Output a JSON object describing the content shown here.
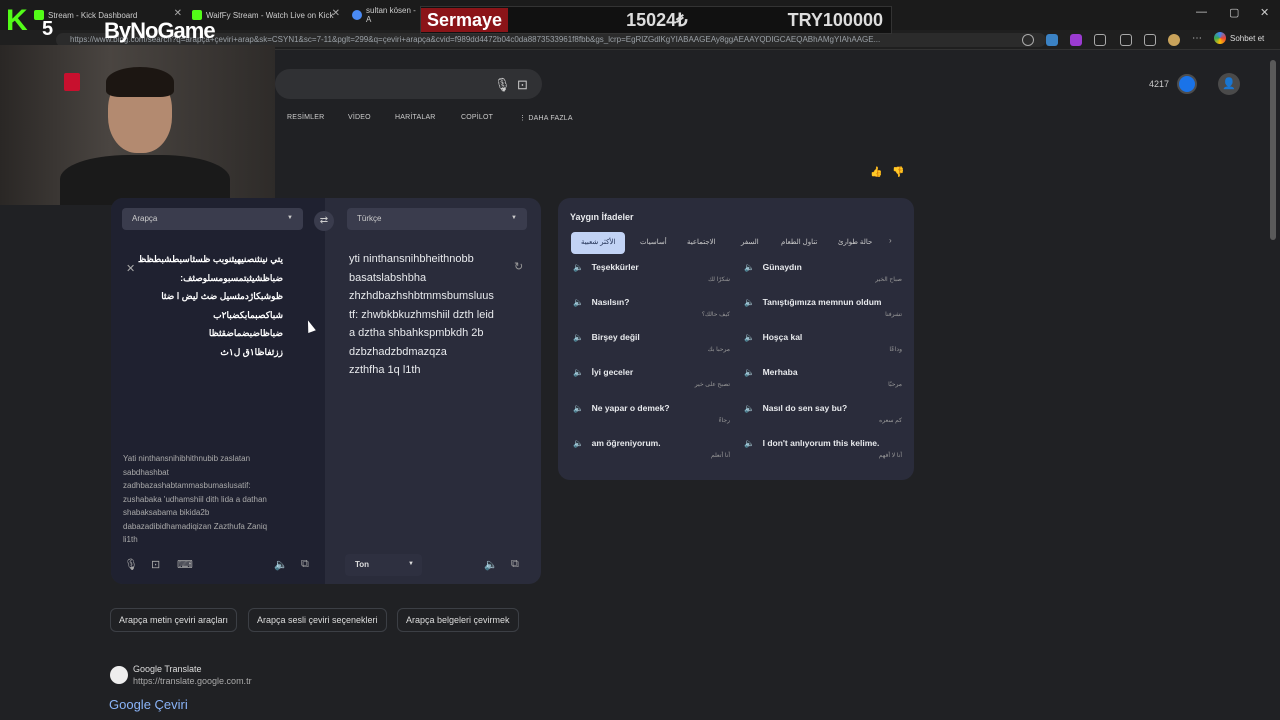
{
  "browser": {
    "tabs": [
      {
        "title": "Stream - Kick Dashboard",
        "color": "#53fc18"
      },
      {
        "title": "WaifFy Stream - Watch Live on Kick",
        "color": "#53fc18"
      },
      {
        "title": "sultan kösen - A",
        "color": "#4a8af4"
      }
    ],
    "url": "https://www.bing.com/search?q=arapça+çeviri+arap&sk=CSYN1&sc=7-11&pglt=299&q=çeviri+arapça&cvid=f989dd4472b04c0da8873533961f8fbb&gs_lcrp=EgRlZGdlKgYIABAAGEAy8ggAEAAYQDIGCAEQABhAMgYIAhAAGE...",
    "sohbet_label": "Sohbet et"
  },
  "overlay": {
    "label": "Sermaye",
    "balance": "15024₺",
    "target": "TRY100000"
  },
  "stream": {
    "brand_k": "K",
    "brand_num": "5",
    "sponsor": "ByNoGame"
  },
  "header": {
    "points": "4217"
  },
  "nav": [
    {
      "label": "RESİMLER"
    },
    {
      "label": "VİDEO"
    },
    {
      "label": "HARİTALAR"
    },
    {
      "label": "COPİLOT"
    },
    {
      "label": "DAHA FAZLA"
    }
  ],
  "translator": {
    "source_lang": "Arapça",
    "target_lang": "Türkçe",
    "source_text": "يتي نينثنصنيهيثنوبب ظسثاسبطشبطظظ\nضباظشيثبتمسبومسلوصثف:\nظوشبكاژدمثسيل ضث ليض ا ضثا\nشباكصبمابكضبا٢ب\nضباظاضبضماضقثظا\nززثفاظا١ق ل١ث",
    "transliteration": "Yati ninthansnihibhithnubib zaslatan\nsabdhashbat\nzadhbazashabtammasbumaslusatif:\nzushabaka 'udhamshiil dith lida a dathan\nshabaksabama bikida2b\n dabazadibidhamadiqizan  Zazthufa Zaniq\nli1th",
    "target_text": "yti ninthansnihbheithnobb\nbasatslabshbha\nzhzhdbazhshbtmmsbumsluus\ntf: zhwbkbkuzhmshiil dzth leid\na dztha shbahkspmbkdh 2b\n dzbzhadzbdmazqza\n zzthfha 1q l1th",
    "tone_label": "Ton"
  },
  "phrases": {
    "title": "Yaygın İfadeler",
    "categories": [
      "الأكثر شعبية",
      "أساسيات",
      "الاجتماعية",
      "السفر",
      "تناول الطعام",
      "حالة طوارئ"
    ],
    "items": [
      {
        "tr": "Teşekkürler",
        "ar": "شكرًا لك"
      },
      {
        "tr": "Günaydın",
        "ar": "صباح الخير"
      },
      {
        "tr": "Nasılsın?",
        "ar": "كيف حالك؟"
      },
      {
        "tr": "Tanıştığımıza memnun oldum",
        "ar": "تشرفنا"
      },
      {
        "tr": "Birşey değil",
        "ar": "مرحبا بك"
      },
      {
        "tr": "Hoşça kal",
        "ar": "وداعًا"
      },
      {
        "tr": "İyi geceler",
        "ar": "تصبح على خير"
      },
      {
        "tr": "Merhaba",
        "ar": "مرحبًا"
      },
      {
        "tr": "Ne yapar o demek?",
        "ar": "رجاءً"
      },
      {
        "tr": "Nasıl do sen say bu?",
        "ar": "كم سعره"
      },
      {
        "tr": "am öğreniyorum.",
        "ar": "أنا أتعلم"
      },
      {
        "tr": "I don't anlıyorum this kelime.",
        "ar": "أنا لا أفهم"
      }
    ]
  },
  "related": [
    "Arapça metin çeviri araçları",
    "Arapça sesli çeviri seçenekleri",
    "Arapça belgeleri çevirmek"
  ],
  "result": {
    "site": "Google Translate",
    "url": "https://translate.google.com.tr",
    "title": "Google Çeviri"
  }
}
